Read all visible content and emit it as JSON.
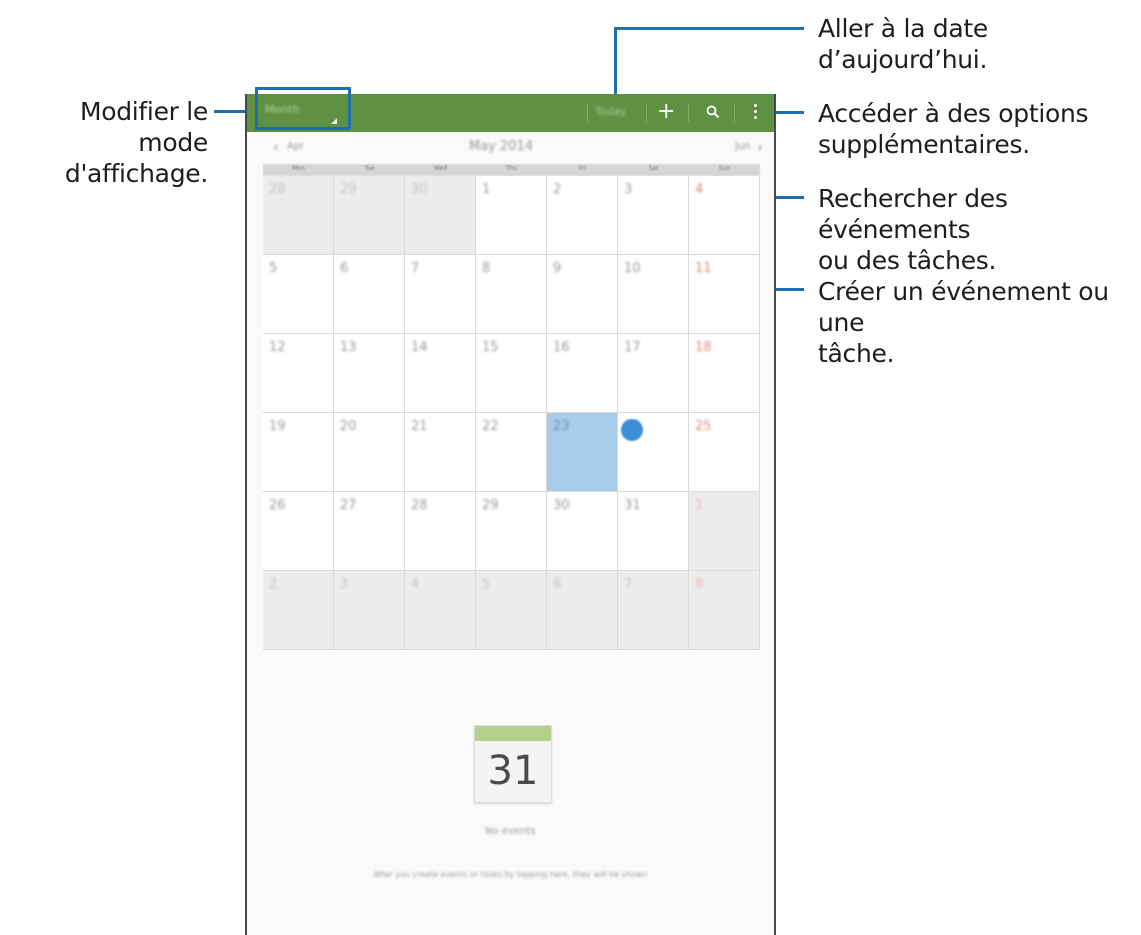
{
  "callouts": {
    "view_mode": [
      "Modifier le mode",
      "d'affichage."
    ],
    "today": "Aller à la date d’aujourd’hui.",
    "more_options": [
      "Accéder à des options",
      "supplémentaires."
    ],
    "search": [
      "Rechercher des événements",
      "ou des tâches."
    ],
    "create": [
      "Créer un événement ou une",
      "tâche."
    ]
  },
  "appbar": {
    "mode_label": "Month",
    "today_label": "Today",
    "plus_icon": "plus-icon",
    "search_icon": "search-icon",
    "more_icon": "more-vertical-icon"
  },
  "month_nav": {
    "prev_label": "Apr",
    "title": "May 2014",
    "next_label": "Jun"
  },
  "weekdays": [
    "Mon",
    "Tue",
    "Wed",
    "Thu",
    "Fri",
    "Sat",
    "Sun"
  ],
  "calendar": {
    "weeks": [
      [
        "28",
        "29",
        "30",
        "1",
        "2",
        "3",
        "4"
      ],
      [
        "5",
        "6",
        "7",
        "8",
        "9",
        "10",
        "11"
      ],
      [
        "12",
        "13",
        "14",
        "15",
        "16",
        "17",
        "18"
      ],
      [
        "19",
        "20",
        "21",
        "22",
        "23",
        "24",
        "25"
      ],
      [
        "26",
        "27",
        "28",
        "29",
        "30",
        "31",
        "1"
      ],
      [
        "2",
        "3",
        "4",
        "5",
        "6",
        "7",
        "8"
      ]
    ],
    "selected_day": "23"
  },
  "empty_state": {
    "icon_day": "31",
    "title": "No events",
    "hint": "After you create events or tasks by tapping here, they will be shown"
  },
  "colors": {
    "appbar": "#5f9142",
    "callout_line": "#1f6fae",
    "selected_cell": "#a8cde9",
    "sunday": "#e08080"
  }
}
